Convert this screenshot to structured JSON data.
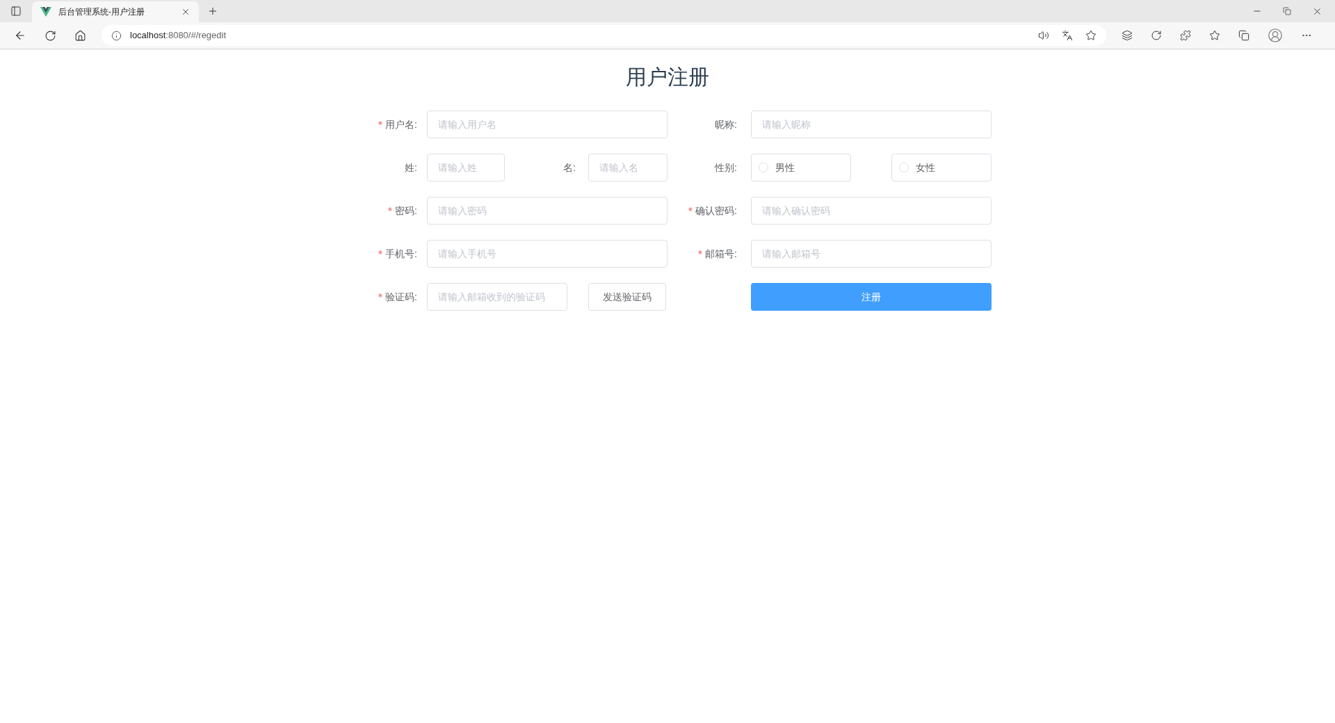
{
  "browser": {
    "tabs": [
      {
        "title": "后台管理系统-用户注册",
        "selected": true
      }
    ],
    "address": {
      "host": "localhost",
      "path": ":8080/#/regedit"
    }
  },
  "form": {
    "title": "用户注册",
    "rows": [
      {
        "left": {
          "kind": "input",
          "label": "用户名:",
          "required": true,
          "placeholder": "请输入用户名"
        },
        "right": {
          "kind": "input",
          "label": "昵称:",
          "required": false,
          "placeholder": "请输入昵称"
        }
      },
      {
        "left": {
          "kind": "pair",
          "items": [
            {
              "label": "姓:",
              "placeholder": "请输入姓"
            },
            {
              "label": "名:",
              "placeholder": "请输入名"
            }
          ]
        },
        "right": {
          "kind": "radio",
          "label": "性别:",
          "options": [
            {
              "label": "男性",
              "selected": false
            },
            {
              "label": "女性",
              "selected": false
            }
          ]
        }
      },
      {
        "left": {
          "kind": "input",
          "label": "密码:",
          "required": true,
          "placeholder": "请输入密码"
        },
        "right": {
          "kind": "input",
          "label": "确认密码:",
          "required": true,
          "placeholder": "请输入确认密码"
        }
      },
      {
        "left": {
          "kind": "input",
          "label": "手机号:",
          "required": true,
          "placeholder": "请输入手机号"
        },
        "right": {
          "kind": "input",
          "label": "邮箱号:",
          "required": true,
          "placeholder": "请输入邮箱号"
        }
      },
      {
        "left": {
          "kind": "code",
          "label": "验证码:",
          "required": true,
          "placeholder": "请输入邮箱收到的验证码",
          "button": "发送验证码"
        },
        "right": {
          "kind": "submit",
          "button": "注册"
        }
      }
    ]
  }
}
